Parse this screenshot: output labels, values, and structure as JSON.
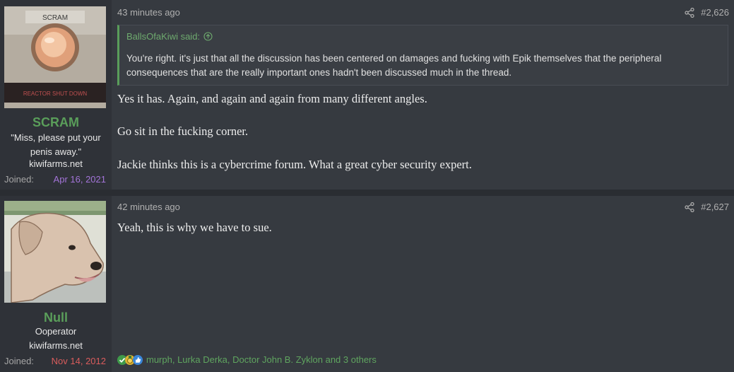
{
  "posts": [
    {
      "author": {
        "name": "SCRAM",
        "title": "\"Miss, please put your penis away.\"",
        "site": "kiwifarms.net",
        "joined_label": "Joined:",
        "joined_date": "Apr 16, 2021",
        "avatar": {
          "label_top": "SCRAM",
          "label_bottom": "REACTOR SHUT DOWN"
        }
      },
      "time": "43 minutes ago",
      "number": "#2,626",
      "quote": {
        "author": "BallsOfaKiwi said:",
        "text": "You're right. it's just that all the discussion has been centered on damages and fucking with Epik themselves that the peripheral consequences that are the really important ones hadn't been discussed much in the thread."
      },
      "paragraphs": [
        "Yes it has. Again, and again and again from many different angles.",
        "Go sit in the fucking corner.",
        "Jackie thinks this is a cybercrime forum. What a great cyber security expert."
      ]
    },
    {
      "author": {
        "name": "Null",
        "title": "Ooperator",
        "site": "kiwifarms.net",
        "joined_label": "Joined:",
        "joined_date": "Nov 14, 2012"
      },
      "time": "42 minutes ago",
      "number": "#2,627",
      "paragraphs": [
        "Yeah, this is why we have to sue."
      ],
      "reactions": "murph, Lurka Derka, Doctor John B. Zyklon and 3 others"
    }
  ],
  "colors": {
    "username": "#5a9e5a",
    "joined_date_1": "#a374d8",
    "joined_date_2": "#d95c5c"
  }
}
